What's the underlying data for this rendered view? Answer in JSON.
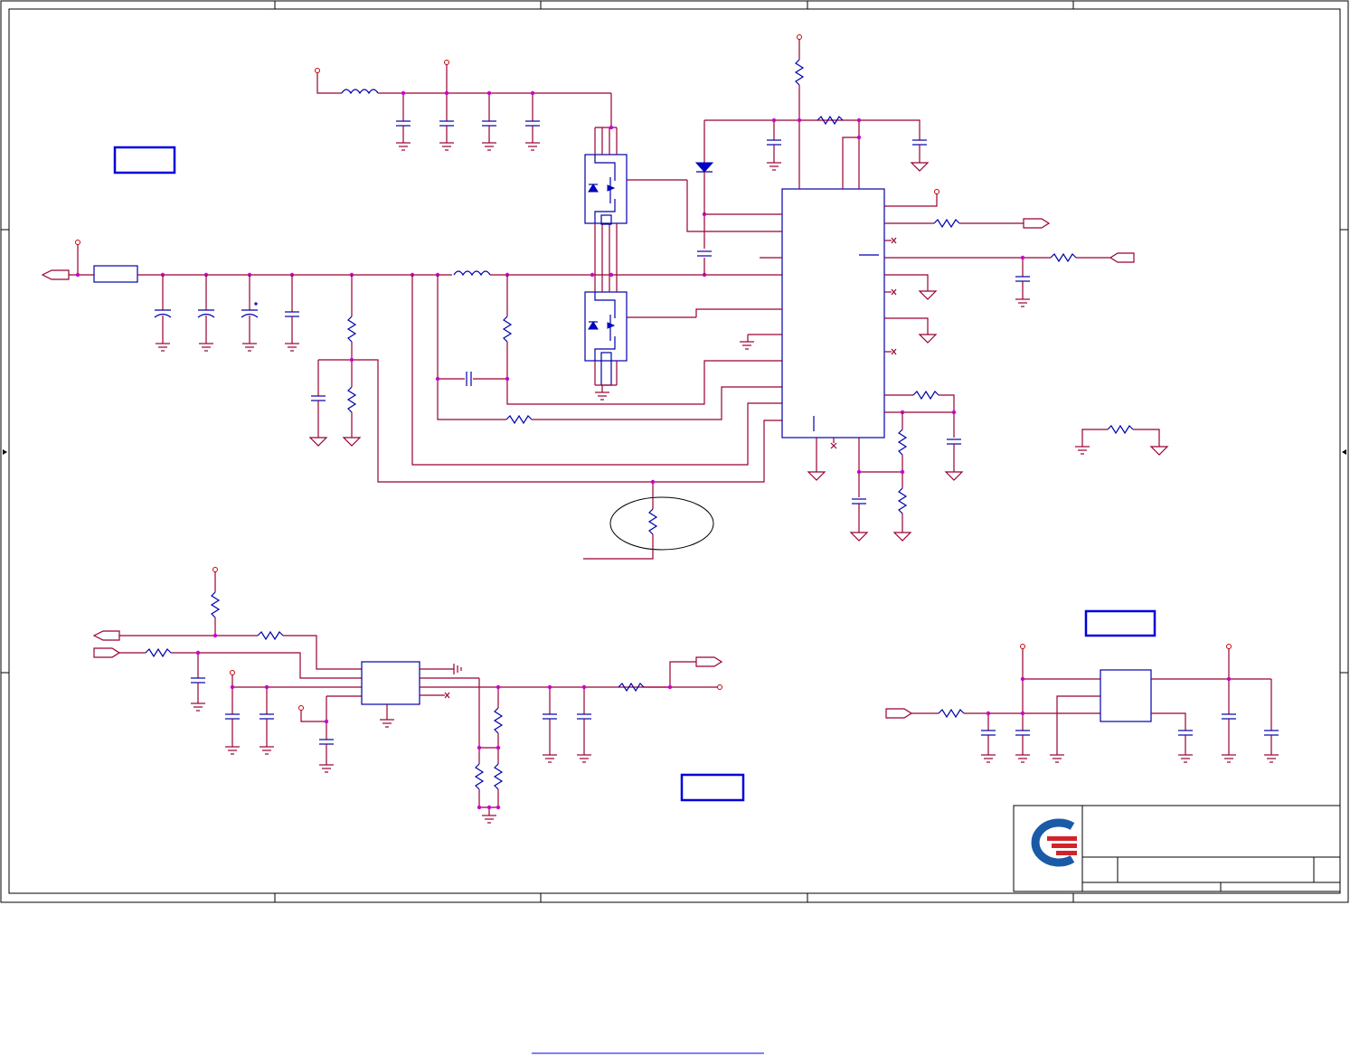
{
  "sheet": {
    "colors": {
      "wire": "#990033",
      "component": "#0000aa",
      "junction": "#cc00cc",
      "frame": "#000000",
      "logo_blue": "#1a5aa6",
      "logo_red": "#d2232a"
    },
    "title_block": {
      "logo": "company-logo-icon"
    }
  }
}
